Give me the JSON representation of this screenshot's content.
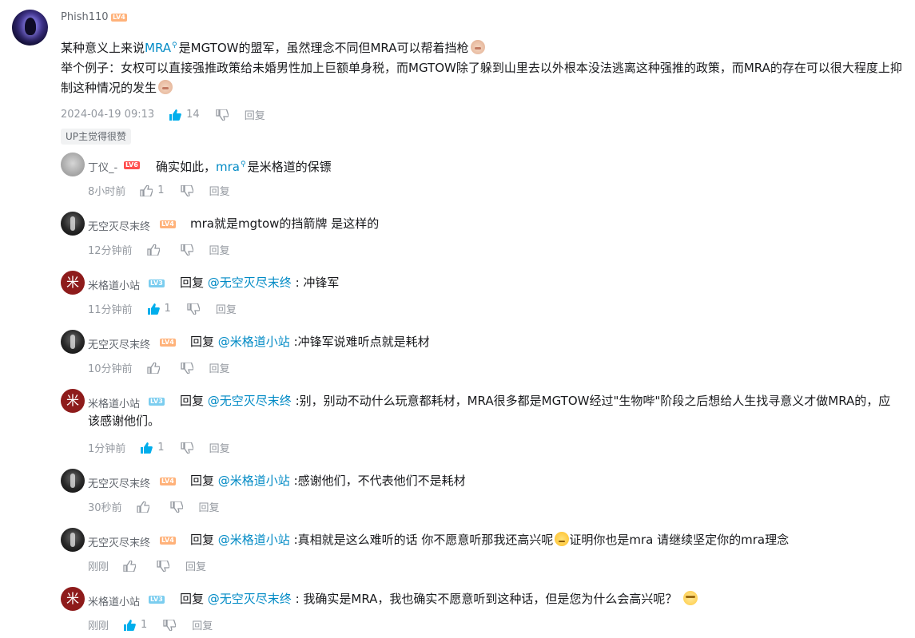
{
  "root": {
    "user": "Phish110",
    "level": "LV4",
    "text_a": "某种意义上来说",
    "link_a": "MRA",
    "text_b": "是MGTOW的盟军，虽然理念不同但MRA可以帮着挡枪",
    "line2": "举个例子：女权可以直接强推政策给未婚男性加上巨额单身税，而MGTOW除了躲到山里去以外根本没法逃离这种强推的政策，而MRA的存在可以很大程度上抑制这种情况的发生",
    "time": "2024-04-19 09:13",
    "likes": "14",
    "reply": "回复",
    "badge": "UP主觉得很赞"
  },
  "replies": [
    {
      "user": "丁仪_-",
      "level": "LV6",
      "prefix": "",
      "mention": "",
      "text_a": "确实如此，",
      "link": "mra",
      "text_b": "是米格道的保镖",
      "time": "8小时前",
      "likes": "1",
      "reply": "回复"
    },
    {
      "user": "无空灭尽末终",
      "level": "LV4",
      "prefix": "",
      "mention": "",
      "text": "mra就是mgtow的挡箭牌 是这样的",
      "time": "12分钟前",
      "likes": "",
      "reply": "回复"
    },
    {
      "user": "米格道小站",
      "level": "LV3",
      "prefix": "回复 ",
      "mention": "@无空灭尽末终",
      "text": " : 冲锋军",
      "time": "11分钟前",
      "likes": "1",
      "reply": "回复"
    },
    {
      "user": "无空灭尽末终",
      "level": "LV4",
      "prefix": "回复 ",
      "mention": "@米格道小站",
      "text": " :冲锋军说难听点就是耗材",
      "time": "10分钟前",
      "likes": "",
      "reply": "回复"
    },
    {
      "user": "米格道小站",
      "level": "LV3",
      "prefix": "回复 ",
      "mention": "@无空灭尽末终",
      "text": " :别，别动不动什么玩意都耗材，MRA很多都是MGTOW经过\"生物哔\"阶段之后想给人生找寻意义才做MRA的，应该感谢他们。",
      "time": "1分钟前",
      "likes": "1",
      "reply": "回复"
    },
    {
      "user": "无空灭尽末终",
      "level": "LV4",
      "prefix": "回复 ",
      "mention": "@米格道小站",
      "text": " :感谢他们，不代表他们不是耗材",
      "time": "30秒前",
      "likes": "",
      "reply": "回复"
    },
    {
      "user": "无空灭尽末终",
      "level": "LV4",
      "prefix": "回复 ",
      "mention": "@米格道小站",
      "text_a": " :真相就是这么难听的话 你不愿意听那我还高兴呢",
      "text_b": "证明你也是mra 请继续坚定你的mra理念",
      "time": "刚刚",
      "likes": "",
      "reply": "回复"
    },
    {
      "user": "米格道小站",
      "level": "LV3",
      "prefix": "回复 ",
      "mention": "@无空灭尽末终",
      "text": " : 我确实是MRA，我也确实不愿意听到这种话，但是您为什么会高兴呢？",
      "time": "刚刚",
      "likes": "1",
      "reply": "回复"
    }
  ],
  "colors": {
    "link": "#008ac5",
    "liked": "#00aeec",
    "meta": "#9499a0"
  },
  "icons": {
    "like": "thumb-up-icon",
    "dislike": "thumb-down-icon",
    "search": "search-icon"
  }
}
